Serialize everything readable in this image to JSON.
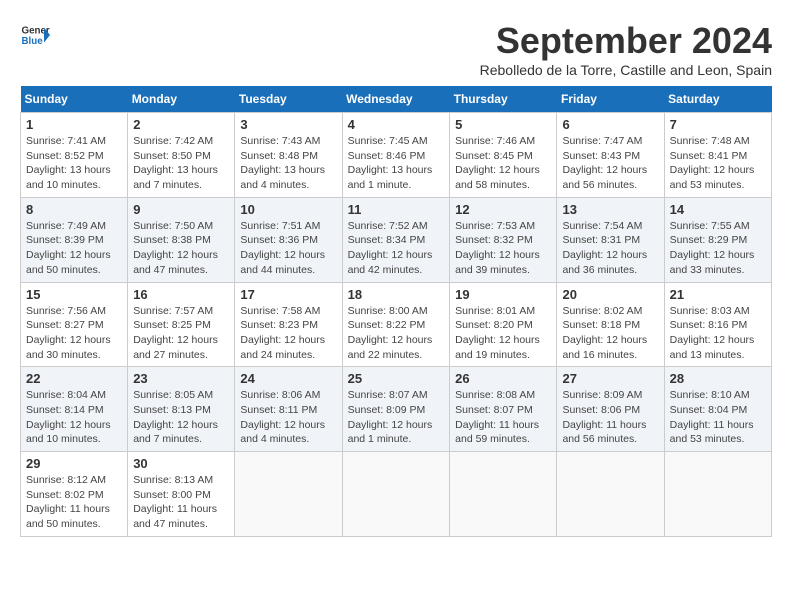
{
  "logo": {
    "text_general": "General",
    "text_blue": "Blue"
  },
  "title": "September 2024",
  "subtitle": "Rebolledo de la Torre, Castille and Leon, Spain",
  "weekdays": [
    "Sunday",
    "Monday",
    "Tuesday",
    "Wednesday",
    "Thursday",
    "Friday",
    "Saturday"
  ],
  "weeks": [
    [
      {
        "day": "1",
        "info": "Sunrise: 7:41 AM\nSunset: 8:52 PM\nDaylight: 13 hours and 10 minutes."
      },
      {
        "day": "2",
        "info": "Sunrise: 7:42 AM\nSunset: 8:50 PM\nDaylight: 13 hours and 7 minutes."
      },
      {
        "day": "3",
        "info": "Sunrise: 7:43 AM\nSunset: 8:48 PM\nDaylight: 13 hours and 4 minutes."
      },
      {
        "day": "4",
        "info": "Sunrise: 7:45 AM\nSunset: 8:46 PM\nDaylight: 13 hours and 1 minute."
      },
      {
        "day": "5",
        "info": "Sunrise: 7:46 AM\nSunset: 8:45 PM\nDaylight: 12 hours and 58 minutes."
      },
      {
        "day": "6",
        "info": "Sunrise: 7:47 AM\nSunset: 8:43 PM\nDaylight: 12 hours and 56 minutes."
      },
      {
        "day": "7",
        "info": "Sunrise: 7:48 AM\nSunset: 8:41 PM\nDaylight: 12 hours and 53 minutes."
      }
    ],
    [
      {
        "day": "8",
        "info": "Sunrise: 7:49 AM\nSunset: 8:39 PM\nDaylight: 12 hours and 50 minutes."
      },
      {
        "day": "9",
        "info": "Sunrise: 7:50 AM\nSunset: 8:38 PM\nDaylight: 12 hours and 47 minutes."
      },
      {
        "day": "10",
        "info": "Sunrise: 7:51 AM\nSunset: 8:36 PM\nDaylight: 12 hours and 44 minutes."
      },
      {
        "day": "11",
        "info": "Sunrise: 7:52 AM\nSunset: 8:34 PM\nDaylight: 12 hours and 42 minutes."
      },
      {
        "day": "12",
        "info": "Sunrise: 7:53 AM\nSunset: 8:32 PM\nDaylight: 12 hours and 39 minutes."
      },
      {
        "day": "13",
        "info": "Sunrise: 7:54 AM\nSunset: 8:31 PM\nDaylight: 12 hours and 36 minutes."
      },
      {
        "day": "14",
        "info": "Sunrise: 7:55 AM\nSunset: 8:29 PM\nDaylight: 12 hours and 33 minutes."
      }
    ],
    [
      {
        "day": "15",
        "info": "Sunrise: 7:56 AM\nSunset: 8:27 PM\nDaylight: 12 hours and 30 minutes."
      },
      {
        "day": "16",
        "info": "Sunrise: 7:57 AM\nSunset: 8:25 PM\nDaylight: 12 hours and 27 minutes."
      },
      {
        "day": "17",
        "info": "Sunrise: 7:58 AM\nSunset: 8:23 PM\nDaylight: 12 hours and 24 minutes."
      },
      {
        "day": "18",
        "info": "Sunrise: 8:00 AM\nSunset: 8:22 PM\nDaylight: 12 hours and 22 minutes."
      },
      {
        "day": "19",
        "info": "Sunrise: 8:01 AM\nSunset: 8:20 PM\nDaylight: 12 hours and 19 minutes."
      },
      {
        "day": "20",
        "info": "Sunrise: 8:02 AM\nSunset: 8:18 PM\nDaylight: 12 hours and 16 minutes."
      },
      {
        "day": "21",
        "info": "Sunrise: 8:03 AM\nSunset: 8:16 PM\nDaylight: 12 hours and 13 minutes."
      }
    ],
    [
      {
        "day": "22",
        "info": "Sunrise: 8:04 AM\nSunset: 8:14 PM\nDaylight: 12 hours and 10 minutes."
      },
      {
        "day": "23",
        "info": "Sunrise: 8:05 AM\nSunset: 8:13 PM\nDaylight: 12 hours and 7 minutes."
      },
      {
        "day": "24",
        "info": "Sunrise: 8:06 AM\nSunset: 8:11 PM\nDaylight: 12 hours and 4 minutes."
      },
      {
        "day": "25",
        "info": "Sunrise: 8:07 AM\nSunset: 8:09 PM\nDaylight: 12 hours and 1 minute."
      },
      {
        "day": "26",
        "info": "Sunrise: 8:08 AM\nSunset: 8:07 PM\nDaylight: 11 hours and 59 minutes."
      },
      {
        "day": "27",
        "info": "Sunrise: 8:09 AM\nSunset: 8:06 PM\nDaylight: 11 hours and 56 minutes."
      },
      {
        "day": "28",
        "info": "Sunrise: 8:10 AM\nSunset: 8:04 PM\nDaylight: 11 hours and 53 minutes."
      }
    ],
    [
      {
        "day": "29",
        "info": "Sunrise: 8:12 AM\nSunset: 8:02 PM\nDaylight: 11 hours and 50 minutes."
      },
      {
        "day": "30",
        "info": "Sunrise: 8:13 AM\nSunset: 8:00 PM\nDaylight: 11 hours and 47 minutes."
      },
      null,
      null,
      null,
      null,
      null
    ]
  ]
}
